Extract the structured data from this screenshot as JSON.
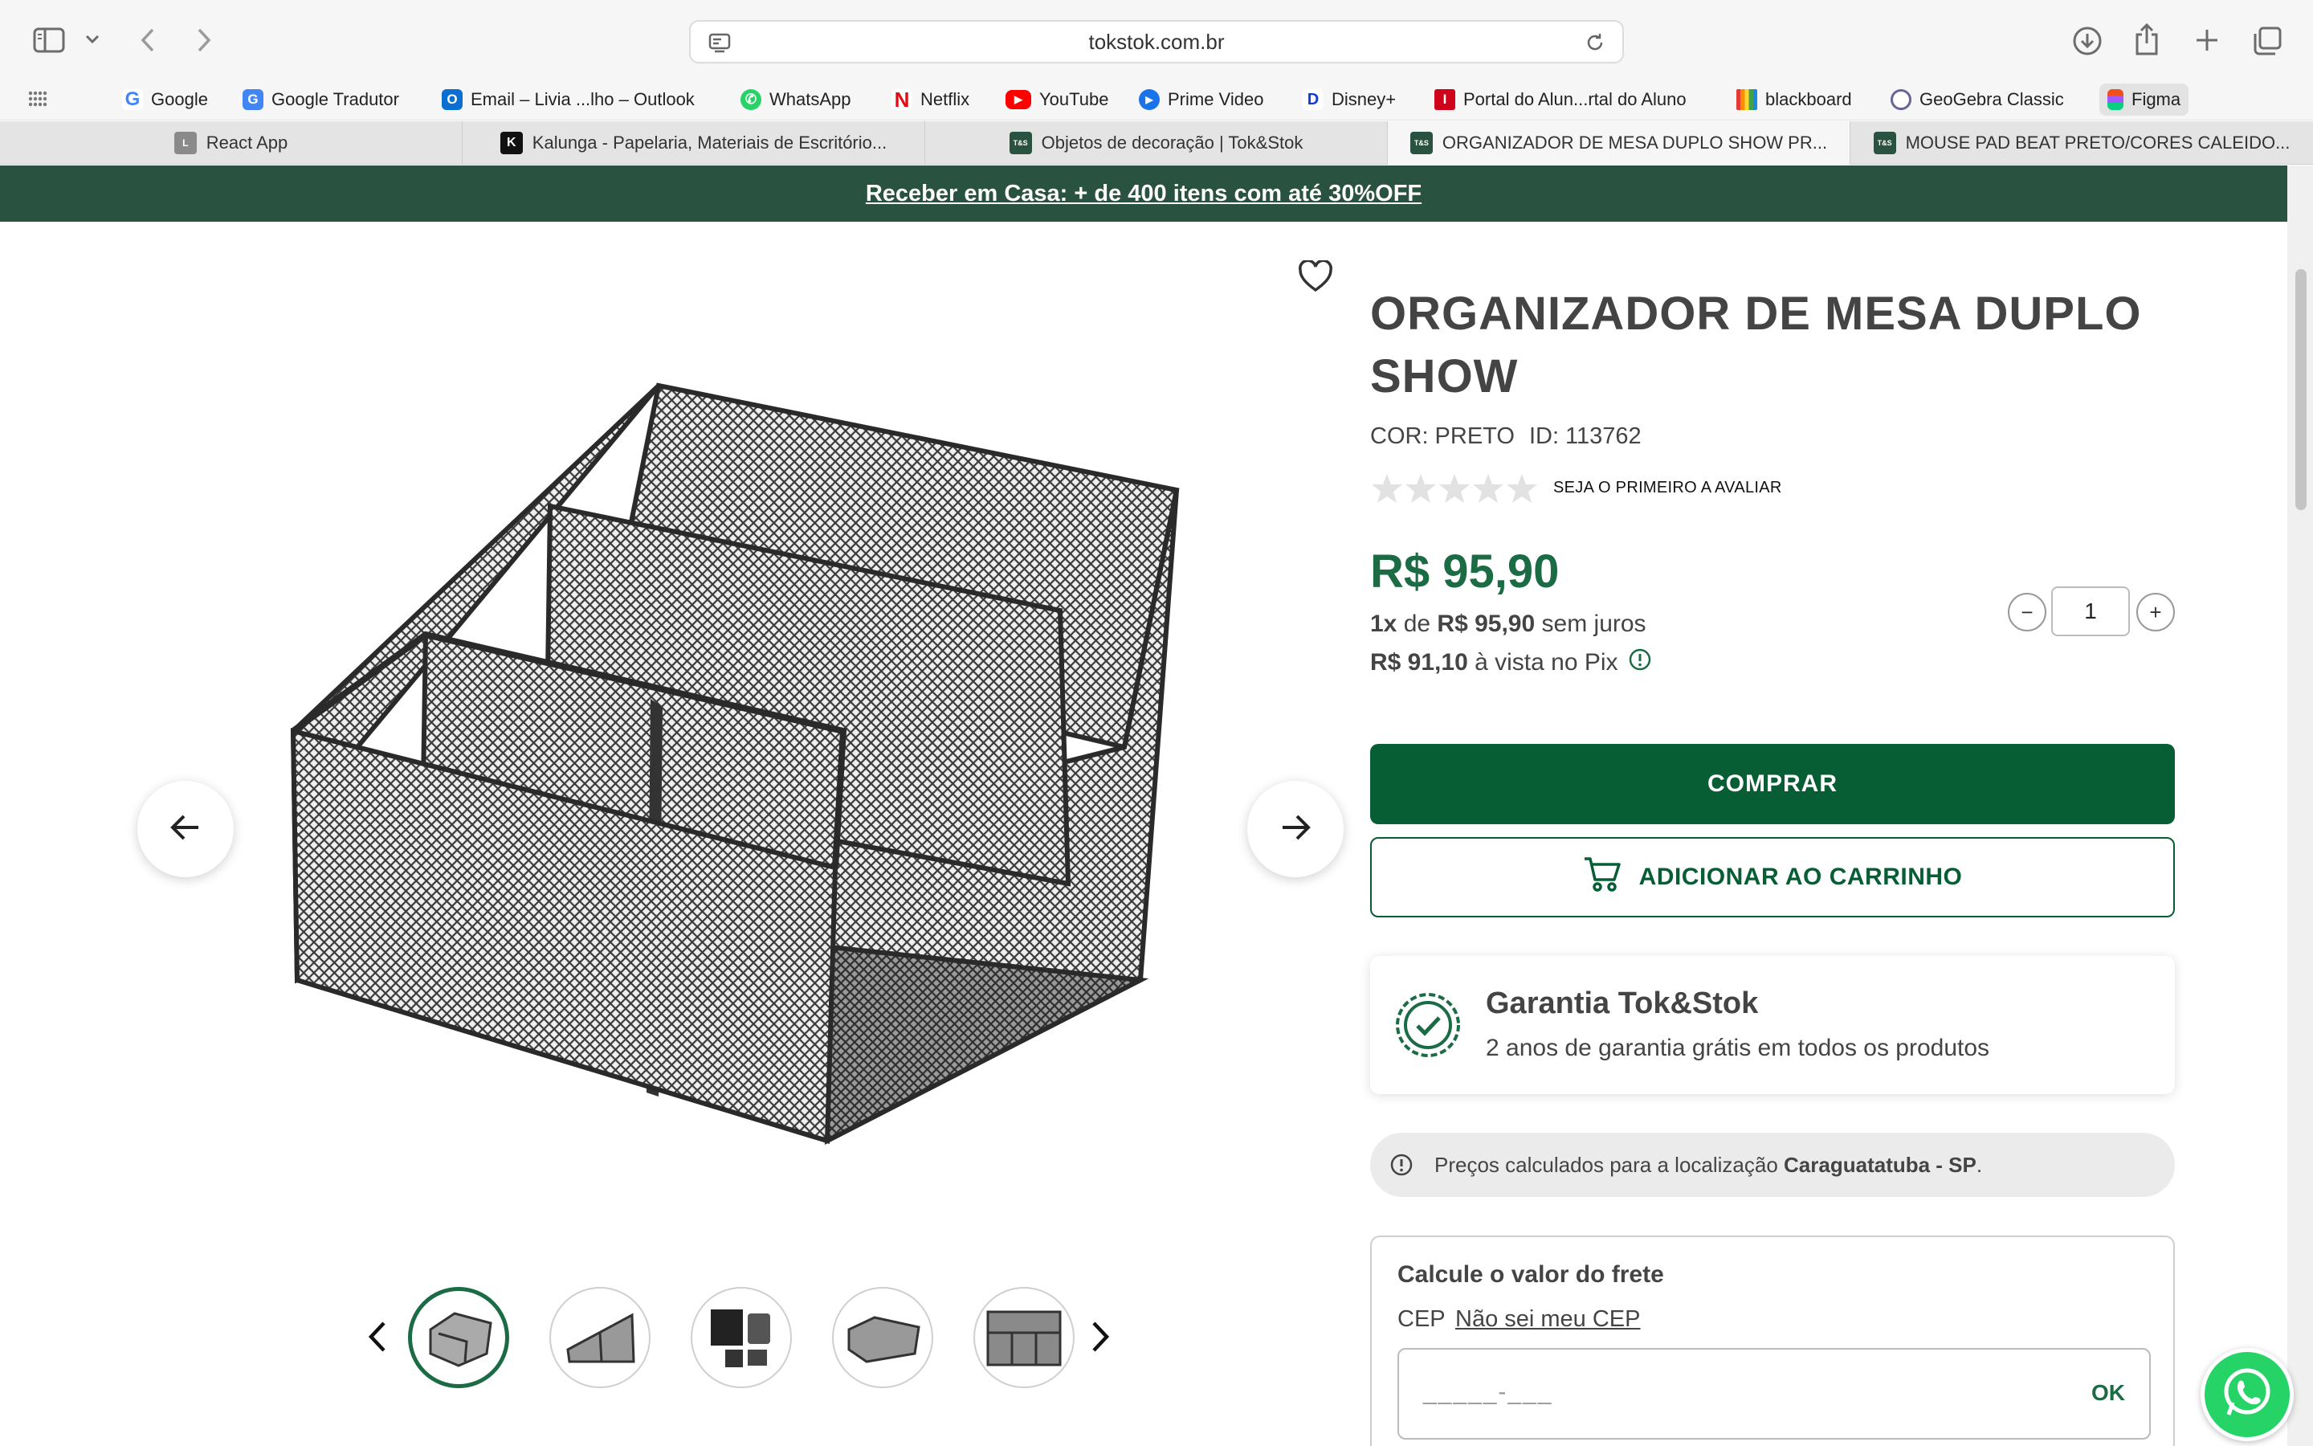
{
  "browser": {
    "url": "tokstok.com.br",
    "bookmarks": [
      {
        "label": "Google",
        "icon": "google-icon",
        "color": "#4285f4"
      },
      {
        "label": "Google Tradutor",
        "icon": "translate-icon",
        "color": "#4285f4"
      },
      {
        "label": "Email – Livia ...lho – Outlook",
        "icon": "outlook-icon",
        "color": "#0a6fd1"
      },
      {
        "label": "WhatsApp",
        "icon": "whatsapp-icon",
        "color": "#25d366"
      },
      {
        "label": "Netflix",
        "icon": "netflix-icon",
        "color": "#e50914"
      },
      {
        "label": "YouTube",
        "icon": "youtube-icon",
        "color": "#ff0000"
      },
      {
        "label": "Prime Video",
        "icon": "prime-video-icon",
        "color": "#1a73e8"
      },
      {
        "label": "Disney+",
        "icon": "disney-icon",
        "color": "#113ccf"
      },
      {
        "label": "Portal do Alun...rtal do Aluno",
        "icon": "portal-icon",
        "color": "#d0021b"
      },
      {
        "label": "blackboard",
        "icon": "blackboard-icon",
        "color": "#222222"
      },
      {
        "label": "GeoGebra Classic",
        "icon": "geogebra-icon",
        "color": "#666699"
      },
      {
        "label": "Figma",
        "icon": "figma-icon",
        "color": "#f24e1e"
      }
    ],
    "tabs": [
      {
        "label": "React App",
        "icon": "L",
        "active": false
      },
      {
        "label": "Kalunga - Papelaria, Materiais de Escritório...",
        "icon": "K",
        "active": false
      },
      {
        "label": "Objetos de decoração | Tok&Stok",
        "icon": "T&S",
        "active": false
      },
      {
        "label": "ORGANIZADOR DE MESA DUPLO SHOW PR...",
        "icon": "T&S",
        "active": true
      },
      {
        "label": "MOUSE PAD BEAT PRETO/CORES CALEIDO...",
        "icon": "T&S",
        "active": false
      }
    ]
  },
  "promo": {
    "text": "Receber em Casa: + de 400 itens com até 30%OFF"
  },
  "gallery": {
    "thumbnails": 5,
    "active_thumbnail": 1
  },
  "product": {
    "title": "ORGANIZADOR DE MESA DUPLO SHOW",
    "color": "COR: PRETO",
    "id": "ID: 113762",
    "rating": 0,
    "rating_cta": "SEJA O PRIMEIRO A AVALIAR",
    "price": "R$ 95,90",
    "installments_prefix": "1x",
    "installments_mid": " de ",
    "installments_value": "R$ 95,90",
    "installments_suffix": " sem juros",
    "pix_value": "R$ 91,10",
    "pix_suffix": " à vista no Pix",
    "quantity": "1"
  },
  "actions": {
    "buy": "COMPRAR",
    "add_to_cart": "ADICIONAR AO CARRINHO"
  },
  "warranty": {
    "title": "Garantia Tok&Stok",
    "subtitle": "2 anos de garantia grátis em todos os produtos"
  },
  "location": {
    "prefix": "Preços calculados para a localização ",
    "city": "Caraguatatuba - SP",
    "suffix": "."
  },
  "freight": {
    "title": "Calcule o valor do frete",
    "cep_label": "CEP",
    "cep_link": "Não sei meu CEP",
    "placeholder": "_____-___",
    "ok": "OK"
  },
  "colors": {
    "brand_green": "#075e35",
    "promo_bg": "#2a5240"
  }
}
